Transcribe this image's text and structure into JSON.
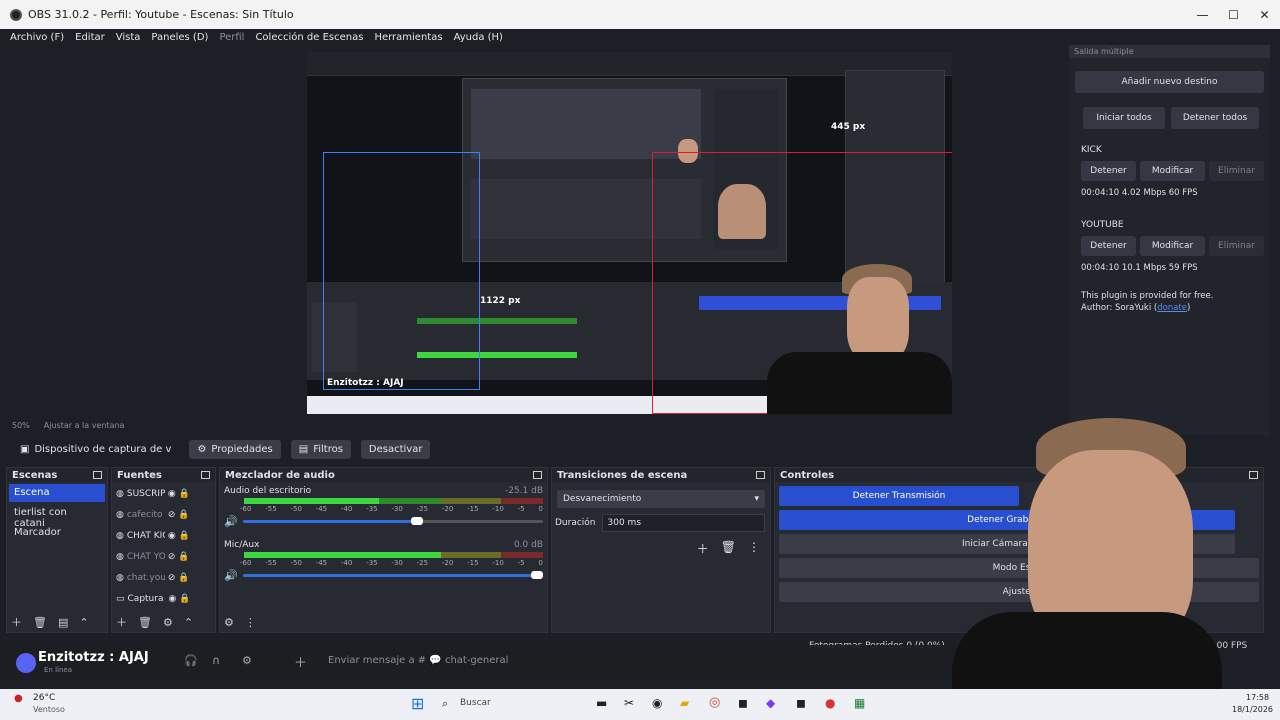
{
  "window": {
    "title": "OBS 31.0.2 - Perfil: Youtube - Escenas: Sin Título"
  },
  "menu": [
    "Archivo (F)",
    "Editar",
    "Vista",
    "Paneles (D)",
    "Perfil",
    "Colección de Escenas",
    "Herramientas",
    "Ayuda (H)"
  ],
  "preview": {
    "zoom": "50%",
    "fit": "Ajustar a la ventana",
    "size_label_top": "445 px",
    "size_label_left": "1122 px",
    "overlay_chat": "Enzitotzz : AJAJ"
  },
  "source_bar": {
    "source_name": "Dispositivo de captura de v",
    "properties": "Propiedades",
    "filters": "Filtros",
    "deactivate": "Desactivar"
  },
  "scenes": {
    "title": "Escenas",
    "items": [
      "Escena",
      "tierlist con catani",
      "Marcador"
    ]
  },
  "sources": {
    "title": "Fuentes",
    "items": [
      {
        "name": "SUSCRIPC"
      },
      {
        "name": "cafecito"
      },
      {
        "name": "CHAT KIC"
      },
      {
        "name": "CHAT YOU"
      },
      {
        "name": "chat.yout"
      },
      {
        "name": "Captura d"
      }
    ]
  },
  "mixer": {
    "title": "Mezclador de audio",
    "ticks": [
      "-60",
      "-55",
      "-50",
      "-45",
      "-40",
      "-35",
      "-30",
      "-25",
      "-20",
      "-15",
      "-10",
      "-5",
      "0"
    ],
    "channels": [
      {
        "name": "Audio del escritorio",
        "db": "-25.1 dB",
        "level": 0.45,
        "volume": 0.6
      },
      {
        "name": "Mic/Aux",
        "db": "0.0 dB",
        "level": 0.66,
        "volume": 1.0
      }
    ]
  },
  "transitions": {
    "title": "Transiciones de escena",
    "selected": "Desvanecimiento",
    "duration_label": "Duración",
    "duration_value": "300 ms"
  },
  "controls": {
    "title": "Controles",
    "stop_stream": "Detener Transmisión",
    "stop_record": "Detener Grabació",
    "virtual_cam": "Iniciar Cámara Virtu",
    "studio_mode": "Modo Estud",
    "settings": "Ajustes"
  },
  "status": {
    "dropped": "Fotogramas Perdidos 0 (0,0%)",
    "fps": "0.00 FPS"
  },
  "multi_output": {
    "header": "Salida múltiple",
    "add": "Añadir nuevo destino",
    "start_all": "Iniciar todos",
    "stop_all": "Detener todos",
    "targets": [
      {
        "name": "KICK",
        "stop": "Detener",
        "edit": "Modificar",
        "delete": "Eliminar",
        "stats": "00:04:10  4.02 Mbps  60 FPS"
      },
      {
        "name": "YOUTUBE",
        "stop": "Detener",
        "edit": "Modificar",
        "delete": "Eliminar",
        "stats": "00:04:10  10.1 Mbps  59 FPS"
      }
    ],
    "note1": "This plugin is provided for free.",
    "note2_prefix": "Author: SoraYuki (",
    "note2_link": "donate",
    "note2_suffix": ")"
  },
  "discord": {
    "user": "Enzitotzz : AJAJ",
    "status": "En línea",
    "message_placeholder": "Enviar mensaje a # 💬 chat-general"
  },
  "taskbar": {
    "temp": "26°C",
    "weather": "Ventoso",
    "search": "Buscar",
    "time": "17:58",
    "date": "18/1/2026"
  }
}
